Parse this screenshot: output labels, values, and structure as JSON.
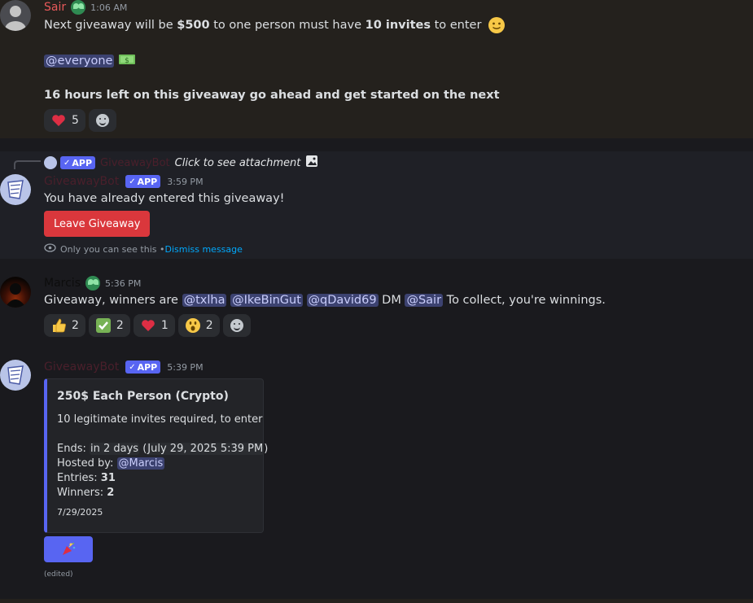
{
  "colors": {
    "bg": "#1a1a1e",
    "highlight": "#24211d",
    "ephemeral": "#1f2026",
    "accent": "#5865f2",
    "danger": "#da373c"
  },
  "msg1": {
    "author": "Sair",
    "time": "1:06 AM",
    "line1_a": "Next giveaway will be ",
    "line1_b": "$500",
    "line1_c": " to one person must have ",
    "line1_d": "10 invites",
    "line1_e": " to enter",
    "mention": "@everyone",
    "line3": "16 hours left on this giveaway go ahead and get started on the next",
    "reactions": [
      {
        "emoji": "heart",
        "count": "5"
      }
    ]
  },
  "msg2": {
    "reply_tag": "APP",
    "reply_name": "GiveawayBot",
    "reply_text": "Click to see attachment",
    "author": "GiveawayBot",
    "tag": "APP",
    "time": "3:59 PM",
    "text": "You have already entered this giveaway!",
    "button": "Leave Giveaway",
    "ephemeral_note": "Only you can see this • ",
    "dismiss": "Dismiss message"
  },
  "msg3": {
    "author": "Marcis",
    "time": "5:36 PM",
    "text_a": "Giveaway, winners are ",
    "m1": "@txlha",
    "m2": "@IkeBinGut",
    "m3": "@qDavid69",
    "text_b": " DM ",
    "m4": "@Sair",
    "text_c": " To collect, you're winnings.",
    "reactions": [
      {
        "emoji": "thumbs-up",
        "count": "2"
      },
      {
        "emoji": "check",
        "count": "2"
      },
      {
        "emoji": "heart",
        "count": "1"
      },
      {
        "emoji": "surprised",
        "count": "2"
      }
    ]
  },
  "msg4": {
    "author": "GiveawayBot",
    "tag": "APP",
    "time": "5:39 PM",
    "embed": {
      "title": "250$ Each Person (Crypto)",
      "desc": "10 legitimate invites required, to enter",
      "ends_label": "Ends: ",
      "ends_rel": "in 2 days",
      "ends_abs_open": " (",
      "ends_abs": "July 29, 2025 5:39 PM",
      "ends_abs_close": ")",
      "hosted_label": "Hosted by: ",
      "host": "@Marcis",
      "entries_label": "Entries: ",
      "entries": "31",
      "winners_label": "Winners: ",
      "winners": "2",
      "footer": "7/29/2025"
    },
    "edited": "(edited)"
  }
}
